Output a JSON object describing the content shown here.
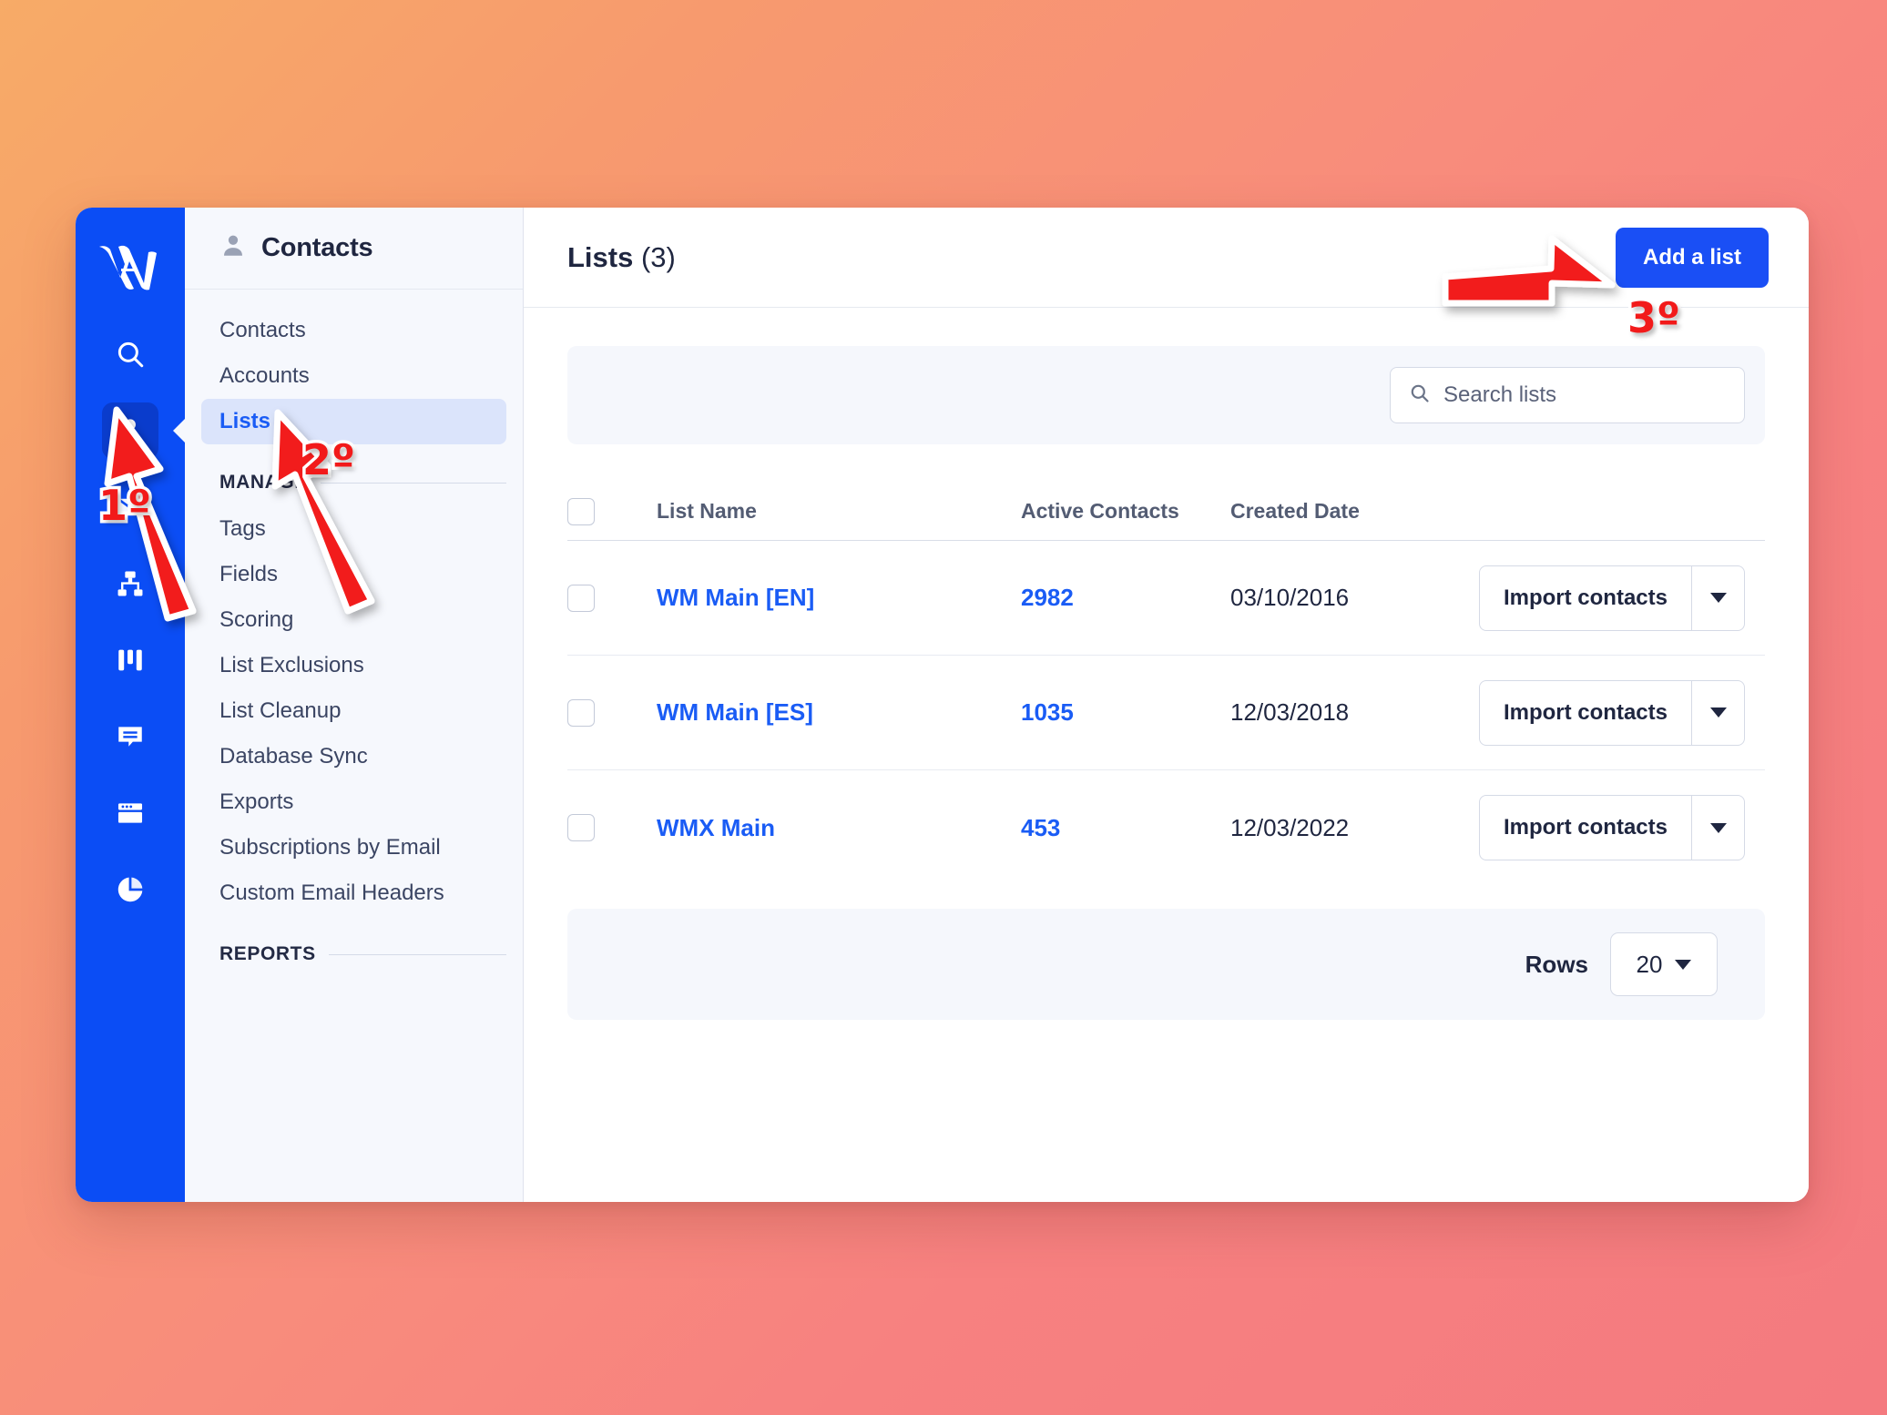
{
  "theme": {
    "brand_blue": "#0b4df5",
    "accent_blue": "#1a4ff5",
    "link_blue": "#1a5cf5",
    "annotation_red": "#f21a1a",
    "panel_bg": "#f6f8fd",
    "background_gradient_from": "#f7ab67",
    "background_gradient_to": "#f47a7f"
  },
  "rail": {
    "logo": "w-logo",
    "items": [
      {
        "icon": "search-icon",
        "active": false
      },
      {
        "icon": "contacts-person-icon",
        "active": true
      },
      {
        "icon": "email-envelope-icon",
        "active": false
      },
      {
        "icon": "automation-sitemap-icon",
        "active": false
      },
      {
        "icon": "kanban-columns-icon",
        "active": false
      },
      {
        "icon": "chat-message-icon",
        "active": false
      },
      {
        "icon": "landing-page-browser-icon",
        "active": false
      },
      {
        "icon": "reports-pie-chart-icon",
        "active": false
      }
    ]
  },
  "nav": {
    "header": {
      "icon": "person-icon",
      "title": "Contacts"
    },
    "primary_items": [
      {
        "label": "Contacts",
        "active": false
      },
      {
        "label": "Accounts",
        "active": false
      },
      {
        "label": "Lists",
        "active": true
      }
    ],
    "sections": [
      {
        "label": "MANAGE",
        "items": [
          {
            "label": "Tags"
          },
          {
            "label": "Fields"
          },
          {
            "label": "Scoring"
          },
          {
            "label": "List Exclusions"
          },
          {
            "label": "List Cleanup"
          },
          {
            "label": "Database Sync"
          },
          {
            "label": "Exports"
          },
          {
            "label": "Subscriptions by Email"
          },
          {
            "label": "Custom Email Headers"
          }
        ]
      },
      {
        "label": "REPORTS",
        "items": []
      }
    ]
  },
  "header": {
    "title": "Lists",
    "count": "(3)",
    "add_button": "Add a list"
  },
  "search": {
    "placeholder": "Search lists",
    "value": "",
    "icon": "search-icon"
  },
  "table": {
    "columns": [
      "List Name",
      "Active Contacts",
      "Created Date"
    ],
    "rows": [
      {
        "name": "WM Main [EN]",
        "active_contacts": "2982",
        "created_date": "03/10/2016",
        "action": "Import contacts"
      },
      {
        "name": "WM Main [ES]",
        "active_contacts": "1035",
        "created_date": "12/03/2018",
        "action": "Import contacts"
      },
      {
        "name": "WMX Main",
        "active_contacts": "453",
        "created_date": "12/03/2022",
        "action": "Import contacts"
      }
    ]
  },
  "footer": {
    "rows_label": "Rows",
    "rows_value": "20"
  },
  "annotations": [
    {
      "id": "step-1",
      "label": "1º",
      "target": "contacts-rail-icon"
    },
    {
      "id": "step-2",
      "label": "2º",
      "target": "lists-nav-item"
    },
    {
      "id": "step-3",
      "label": "3º",
      "target": "add-list-button"
    }
  ]
}
